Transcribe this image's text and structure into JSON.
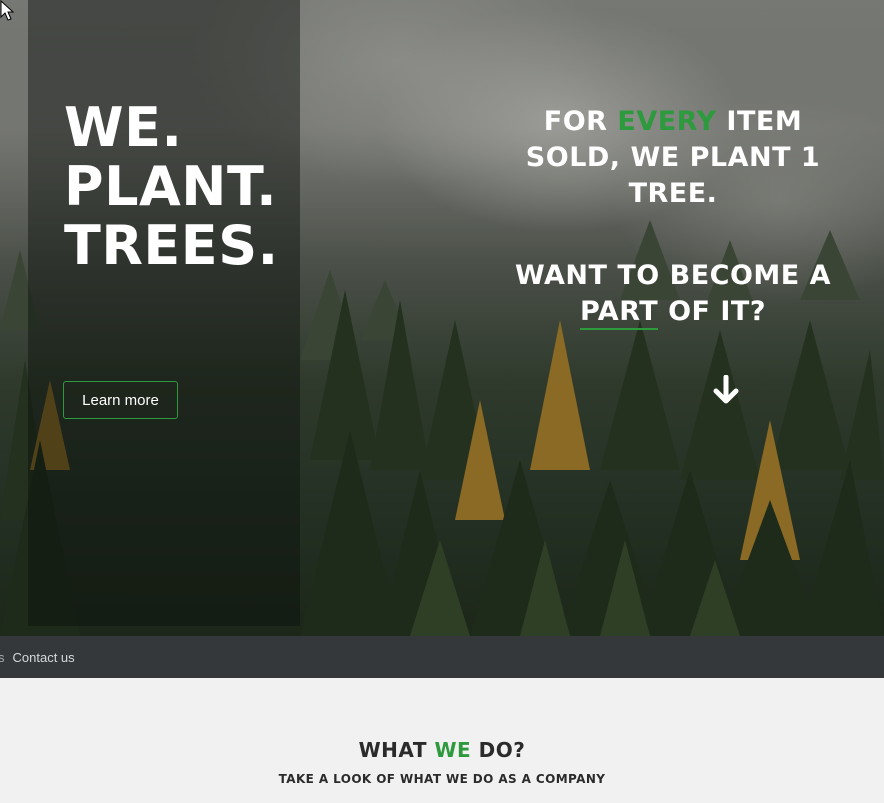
{
  "hero": {
    "title_lines": [
      "WE.",
      "PLANT.",
      "TREES."
    ],
    "learn_more_label": "Learn more",
    "pitch": {
      "line1_pre": "FOR ",
      "line1_highlight": "EVERY",
      "line1_post": " ITEM SOLD, WE PLANT 1 TREE.",
      "line2_pre": "WANT TO BECOME A ",
      "line2_underlined": "PART",
      "line2_post": " OF IT?"
    },
    "scroll_icon": "arrow-down-icon"
  },
  "nav": {
    "partial_prefix": "s",
    "contact_label": "Contact us"
  },
  "section": {
    "title_pre": "WHAT ",
    "title_highlight": "WE",
    "title_post": " DO?",
    "subtitle": "TAKE A LOOK OF WHAT WE DO AS A COMPANY"
  },
  "colors": {
    "accent_green": "#2e9a3e",
    "nav_bg": "#35383a",
    "section_bg": "#f1f1f1"
  }
}
